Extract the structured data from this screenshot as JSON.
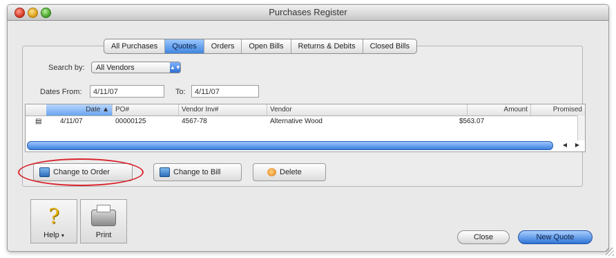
{
  "window": {
    "title": "Purchases Register"
  },
  "tabs": [
    {
      "label": "All Purchases",
      "selected": false
    },
    {
      "label": "Quotes",
      "selected": true
    },
    {
      "label": "Orders",
      "selected": false
    },
    {
      "label": "Open Bills",
      "selected": false
    },
    {
      "label": "Returns & Debits",
      "selected": false
    },
    {
      "label": "Closed Bills",
      "selected": false
    }
  ],
  "filters": {
    "search_by_label": "Search by:",
    "search_by_value": "All Vendors",
    "dates_from_label": "Dates From:",
    "date_from": "4/11/07",
    "to_label": "To:",
    "date_to": "4/11/07"
  },
  "table": {
    "columns": [
      "Date",
      "PO#",
      "Vendor Inv#",
      "Vendor",
      "Amount",
      "Promised"
    ],
    "sort_indicator": "▲",
    "rows": [
      {
        "marker": "▤",
        "date": "4/11/07",
        "po": "00000125",
        "vendor_inv": "4567-78",
        "vendor": "Alternative Wood",
        "amount": "$563.07",
        "promised": ""
      }
    ]
  },
  "actions": {
    "change_to_order": "Change to Order",
    "change_to_bill": "Change to Bill",
    "delete": "Delete"
  },
  "toolbar": {
    "help": "Help",
    "print": "Print"
  },
  "footer": {
    "close": "Close",
    "new_quote": "New Quote"
  },
  "colors": {
    "accent_blue": "#3f86e0",
    "highlight_red": "#d9232b"
  }
}
